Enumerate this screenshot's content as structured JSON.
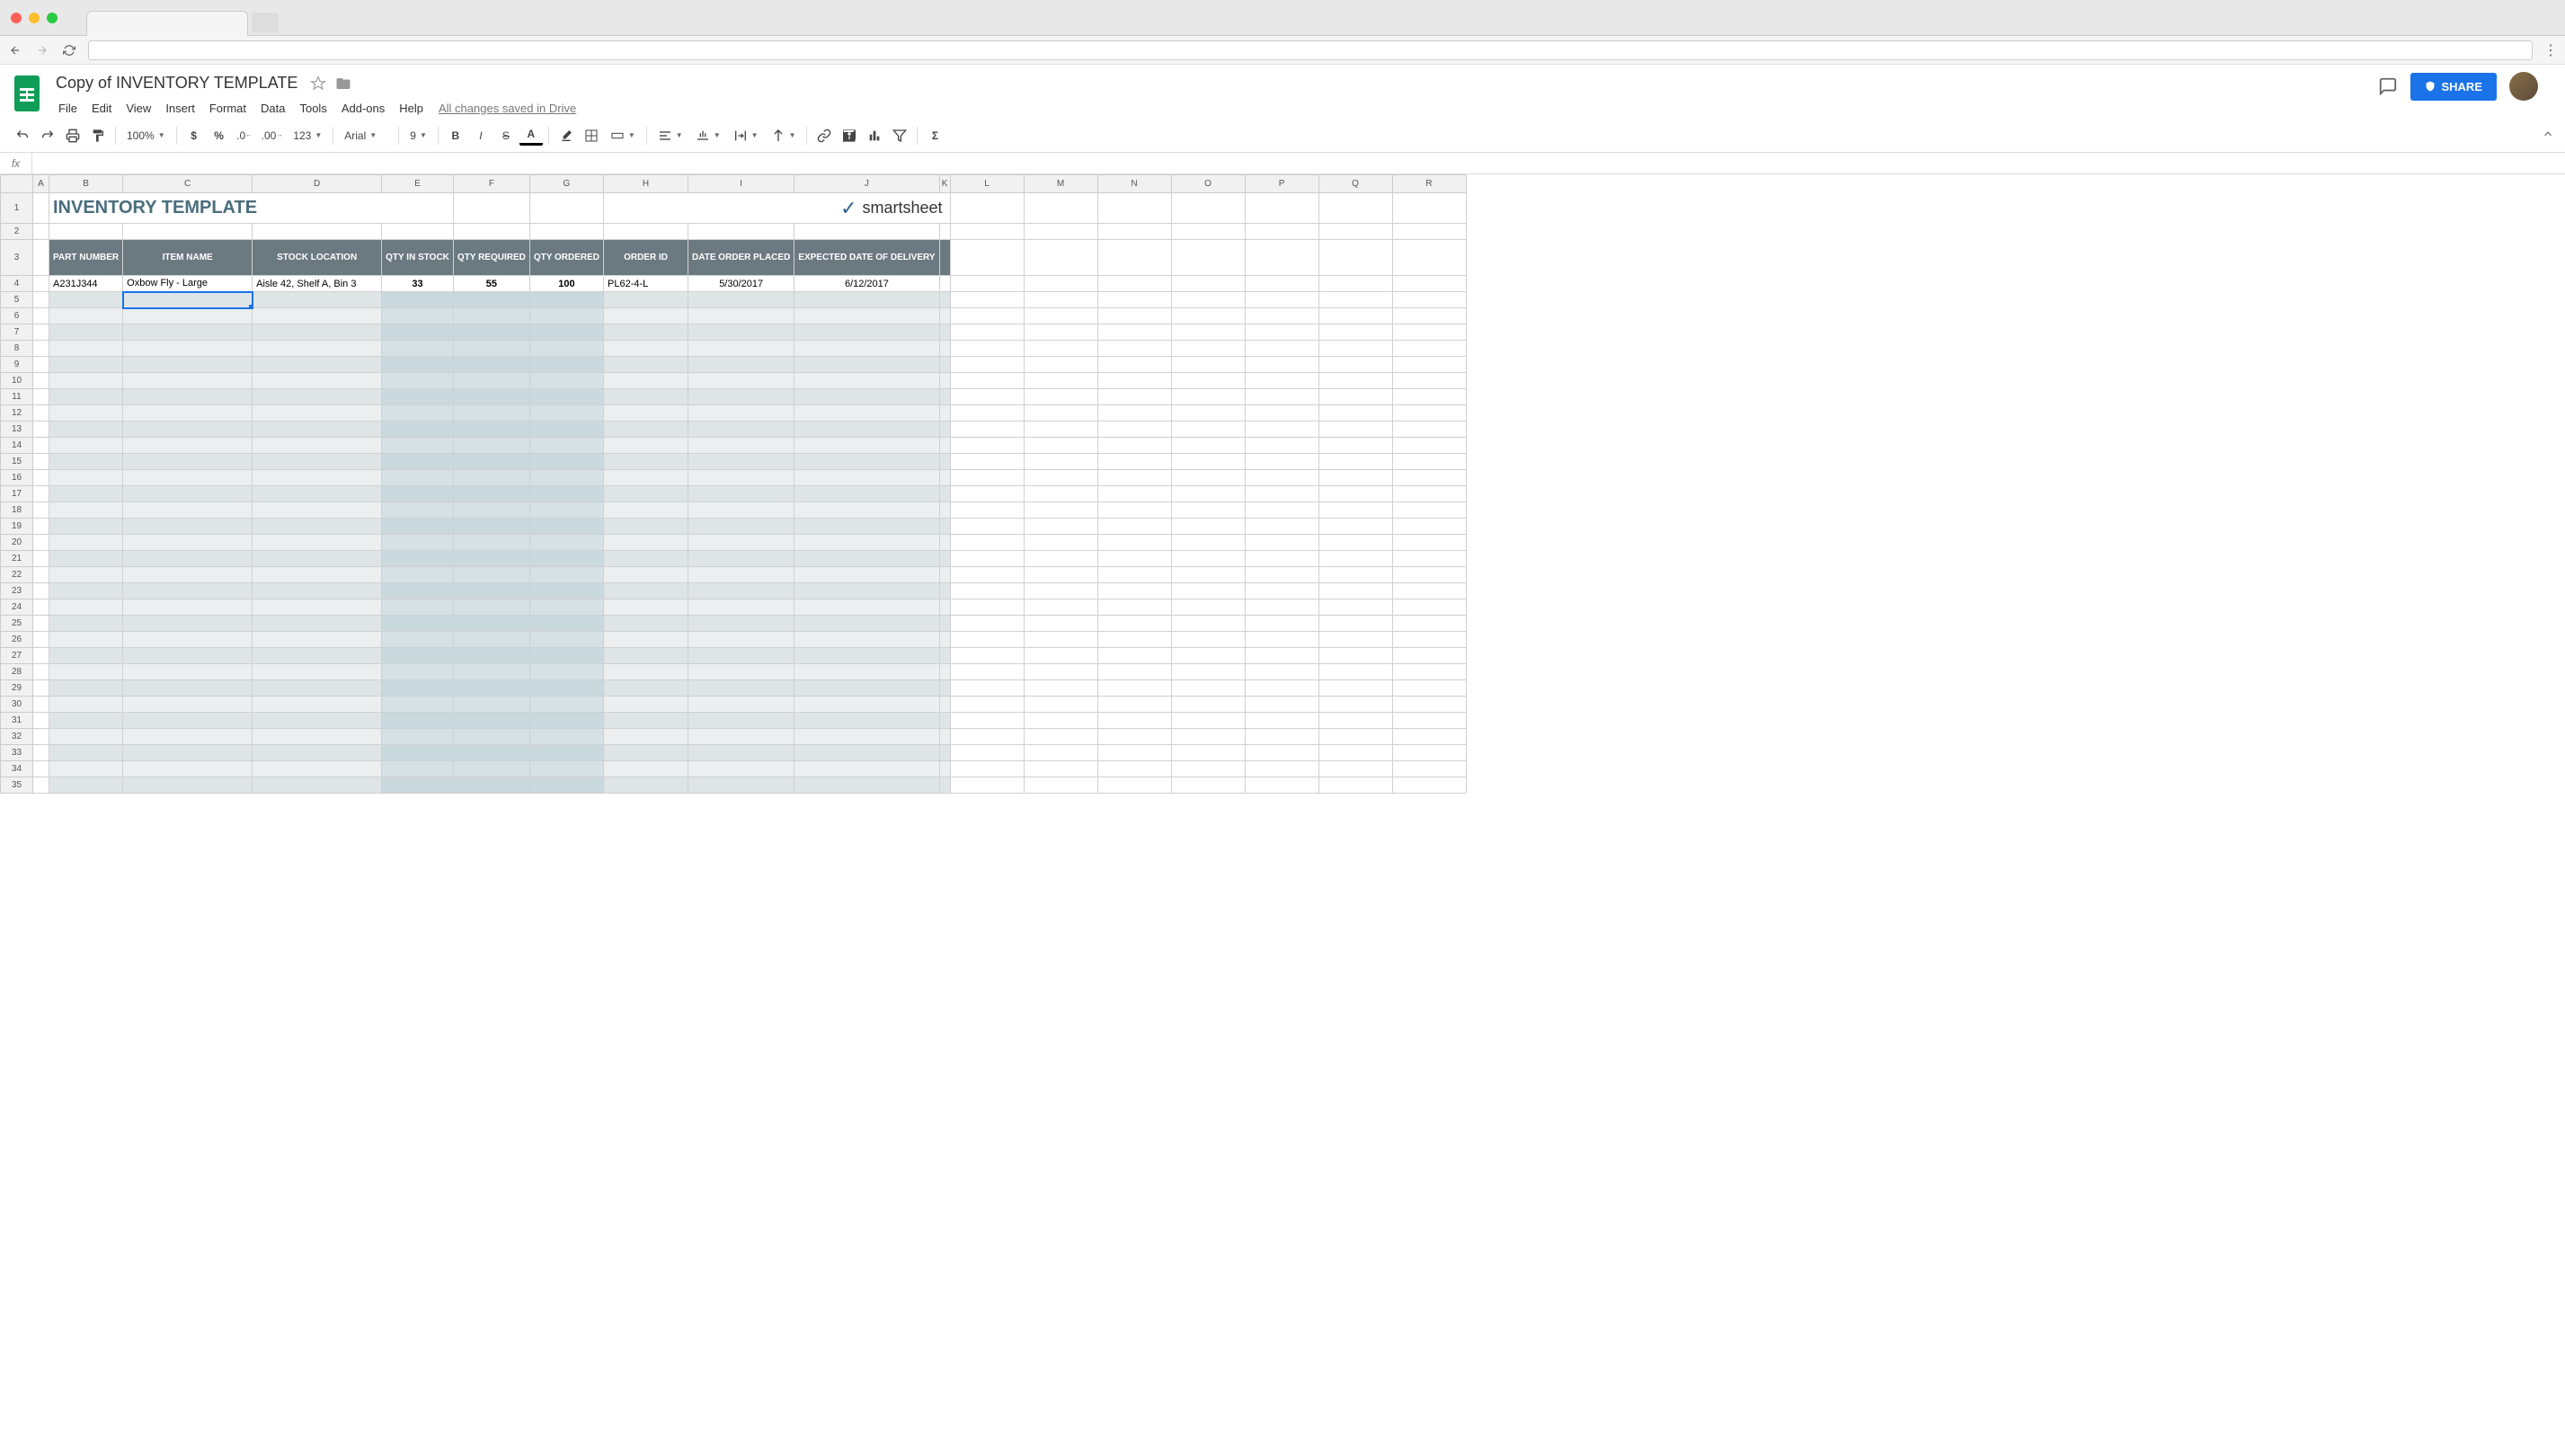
{
  "browser": {
    "url_placeholder": ""
  },
  "doc": {
    "title": "Copy of INVENTORY TEMPLATE",
    "save_status": "All changes saved in Drive"
  },
  "menus": [
    "File",
    "Edit",
    "View",
    "Insert",
    "Format",
    "Data",
    "Tools",
    "Add-ons",
    "Help"
  ],
  "toolbar": {
    "zoom": "100%",
    "font": "Arial",
    "font_size": "9",
    "number_fmt": "123"
  },
  "share_label": "SHARE",
  "formula": {
    "fx": "fx",
    "value": ""
  },
  "columns": [
    "A",
    "B",
    "C",
    "D",
    "E",
    "F",
    "G",
    "H",
    "I",
    "J",
    "K",
    "L",
    "M",
    "N",
    "O",
    "P",
    "Q",
    "R"
  ],
  "template": {
    "title": "INVENTORY TEMPLATE",
    "logo_text": "smartsheet",
    "headers": {
      "part_number": "PART NUMBER",
      "item_name": "ITEM NAME",
      "stock_location": "STOCK LOCATION",
      "qty_in_stock": "QTY IN STOCK",
      "qty_required": "QTY REQUIRED",
      "qty_ordered": "QTY ORDERED",
      "order_id": "ORDER ID",
      "date_order_placed": "DATE ORDER PLACED",
      "expected_delivery": "EXPECTED DATE OF DELIVERY"
    },
    "row": {
      "part_number": "A231J344",
      "item_name": "Oxbow Fly - Large",
      "stock_location": "Aisle 42, Shelf A, Bin 3",
      "qty_in_stock": "33",
      "qty_required": "55",
      "qty_ordered": "100",
      "order_id": "PL62-4-L",
      "date_order_placed": "5/30/2017",
      "expected_delivery": "6/12/2017"
    }
  },
  "selected_cell": "C5"
}
